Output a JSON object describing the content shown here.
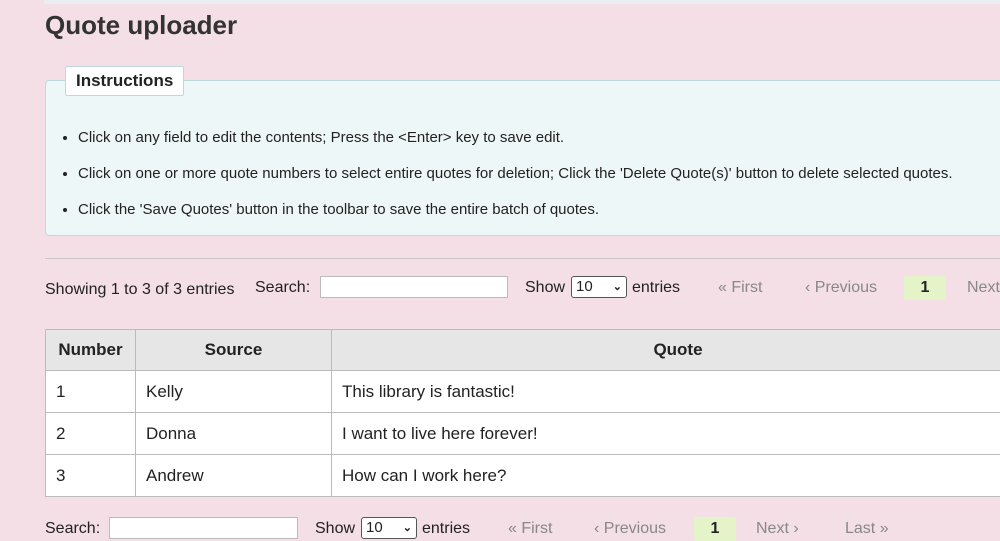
{
  "page": {
    "title": "Quote uploader"
  },
  "instructions": {
    "legend": "Instructions",
    "items": [
      "Click on any field to edit the contents; Press the <Enter> key to save edit.",
      "Click on one or more quote numbers to select entire quotes for deletion; Click the 'Delete Quote(s)' button to delete selected quotes.",
      "Click the 'Save Quotes' button in the toolbar to save the entire batch of quotes."
    ]
  },
  "top_controls": {
    "info": "Showing 1 to 3 of 3 entries",
    "search_label": "Search:",
    "search_value": "",
    "show_label": "Show",
    "page_size": "10",
    "entries_label": "entries",
    "first": "« First",
    "previous": "‹ Previous",
    "current_page": "1",
    "next": "Next ›"
  },
  "table": {
    "headers": [
      "Number",
      "Source",
      "Quote"
    ],
    "rows": [
      [
        "1",
        "Kelly",
        "This library is fantastic!"
      ],
      [
        "2",
        "Donna",
        "I want to live here forever!"
      ],
      [
        "3",
        "Andrew",
        "How can I work here?"
      ]
    ]
  },
  "bottom_controls": {
    "search_label": "Search:",
    "search_value": "",
    "show_label": "Show",
    "page_size": "10",
    "entries_label": "entries",
    "first": "« First",
    "previous": "‹ Previous",
    "current_page": "1",
    "next": "Next ›",
    "last": "Last »"
  },
  "icons": {
    "select_arrow": "chevron-down-icon"
  },
  "colors": {
    "page_background": "#f3dfe5",
    "instructions_background": "#eef7f7",
    "current_page_highlight": "#e5f3c8",
    "header_background": "#e6e6e6"
  }
}
